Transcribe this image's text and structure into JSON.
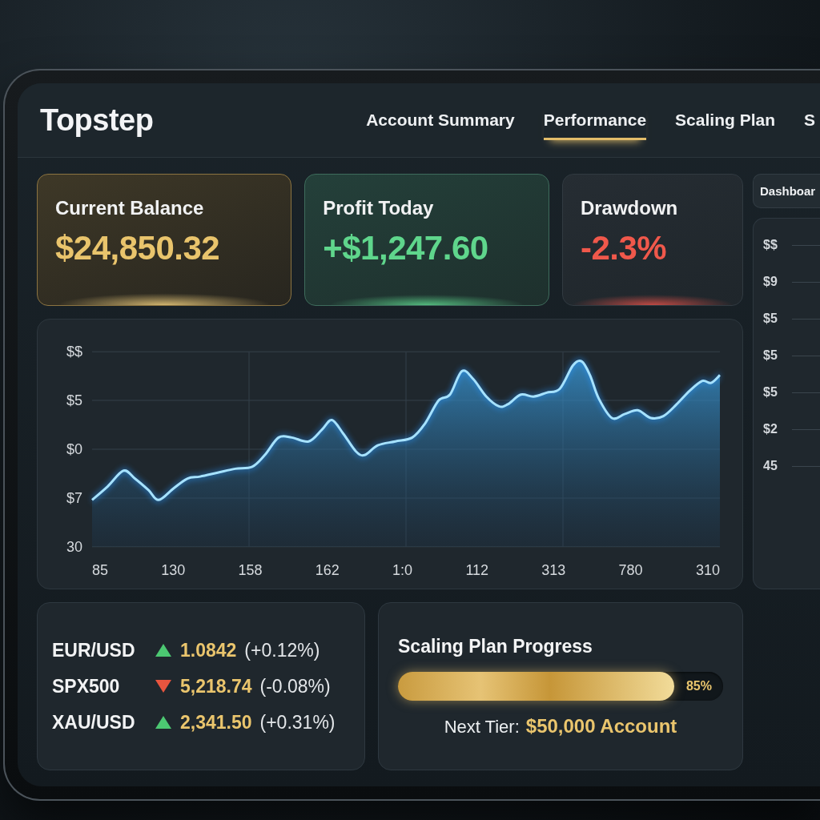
{
  "brand": {
    "name": "Topstep"
  },
  "tabs": [
    {
      "label": "Account Summary",
      "selected": false
    },
    {
      "label": "Performance",
      "selected": true
    },
    {
      "label": "Scaling Plan",
      "selected": false
    },
    {
      "label": "S",
      "selected": false
    }
  ],
  "cards": [
    {
      "kind": "balance",
      "label": "Current Balance",
      "value": "$24,850.32"
    },
    {
      "kind": "gain",
      "label": "Profit Today",
      "value": "+$1,247.60"
    },
    {
      "kind": "loss",
      "label": "Drawdown",
      "value": "-2.3%"
    }
  ],
  "chart": {
    "y_labels": [
      "$$",
      "$5",
      "$0",
      "$7",
      "30"
    ],
    "x_labels": [
      "85",
      "130",
      "158",
      "162",
      "1:0",
      "112",
      "313",
      "780",
      "310"
    ]
  },
  "tickers": [
    {
      "symbol": "EUR/USD",
      "rising": true,
      "price": "1.0842",
      "change": "(+0.12%)"
    },
    {
      "symbol": "SPX500",
      "rising": false,
      "price": "5,218.74",
      "change": "(-0.08%)"
    },
    {
      "symbol": "XAU/USD",
      "rising": true,
      "price": "2,341.50",
      "change": "(+0.31%)"
    }
  ],
  "scaling": {
    "title": "Scaling Plan Progress",
    "level": 0.85,
    "reading": "85%",
    "next_tier_label": "Next Tier:",
    "next_tier_value": "$50,000 Account"
  },
  "side_panel": {
    "button": "Dashboar",
    "axis_labels": [
      "$$",
      "$9",
      "$5",
      "$5",
      "$5",
      "$2",
      "45"
    ]
  }
}
